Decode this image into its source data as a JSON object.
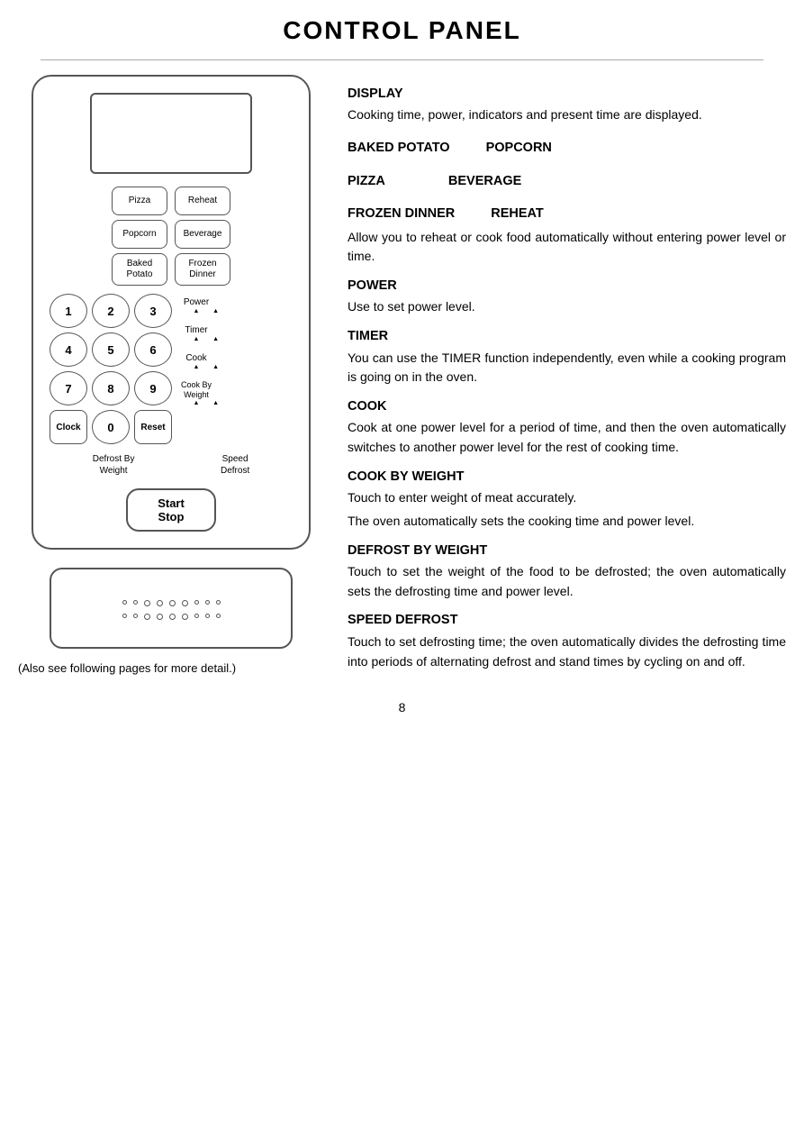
{
  "page": {
    "title": "CONTROL PANEL",
    "page_number": "8",
    "also_see_note": "(Also see following pages for more detail.)"
  },
  "microwave": {
    "preset_buttons": [
      {
        "label": "Pizza",
        "row": 1,
        "col": 1
      },
      {
        "label": "Reheat",
        "row": 1,
        "col": 2
      },
      {
        "label": "Popcorn",
        "row": 2,
        "col": 1
      },
      {
        "label": "Beverage",
        "row": 2,
        "col": 2
      },
      {
        "label": "Baked\nPotato",
        "row": 3,
        "col": 1
      },
      {
        "label": "Frozen\nDinner",
        "row": 3,
        "col": 2
      }
    ],
    "num_keys": [
      "1",
      "2",
      "3",
      "4",
      "5",
      "6",
      "7",
      "8",
      "9",
      "Clock",
      "0",
      "Reset"
    ],
    "func_keys": [
      "Power",
      "Timer",
      "Cook",
      "Cook By\nWeight"
    ],
    "bottom_labels": [
      "Defrost By\nWeight",
      "Speed\nDefrost"
    ],
    "start_stop": "Start\nStop",
    "dots_row1": 9,
    "dots_row2": 9
  },
  "right_panel": {
    "sections": [
      {
        "id": "display",
        "title": "DISPLAY",
        "text": "Cooking time, power, indicators and present time are displayed."
      },
      {
        "id": "baked-potato-popcorn",
        "title1": "BAKED POTATO",
        "title2": "POPCORN",
        "text": null
      },
      {
        "id": "pizza-beverage",
        "title1": "PIZZA",
        "title2": "BEVERAGE",
        "text": null
      },
      {
        "id": "frozen-dinner-reheat",
        "title1": "FROZEN DINNER",
        "title2": "REHEAT",
        "text": "Allow you to reheat or cook food automatically without entering power level or time."
      },
      {
        "id": "power",
        "title": "POWER",
        "text": "Use to set power level."
      },
      {
        "id": "timer",
        "title": "TIMER",
        "text": "You can use the TIMER function independently, even while a cooking program is going on in the oven."
      },
      {
        "id": "cook",
        "title": "COOK",
        "text": "Cook at one power level for a period of time, and then the oven automatically switches to another power level for the rest of cooking time."
      },
      {
        "id": "cook-by-weight",
        "title": "COOK BY WEIGHT",
        "text1": "Touch to enter weight of meat accurately.",
        "text2": "The oven automatically sets the cooking time and power level."
      },
      {
        "id": "defrost-by-weight",
        "title": "DEFROST BY WEIGHT",
        "text": "Touch to set the weight of the food to be defrosted; the oven automatically sets the defrosting time and power level."
      },
      {
        "id": "speed-defrost",
        "title": "SPEED DEFROST",
        "text": "Touch to set defrosting time; the oven automatically divides the defrosting time into periods of alternating defrost and stand times by cycling on and off."
      }
    ]
  }
}
